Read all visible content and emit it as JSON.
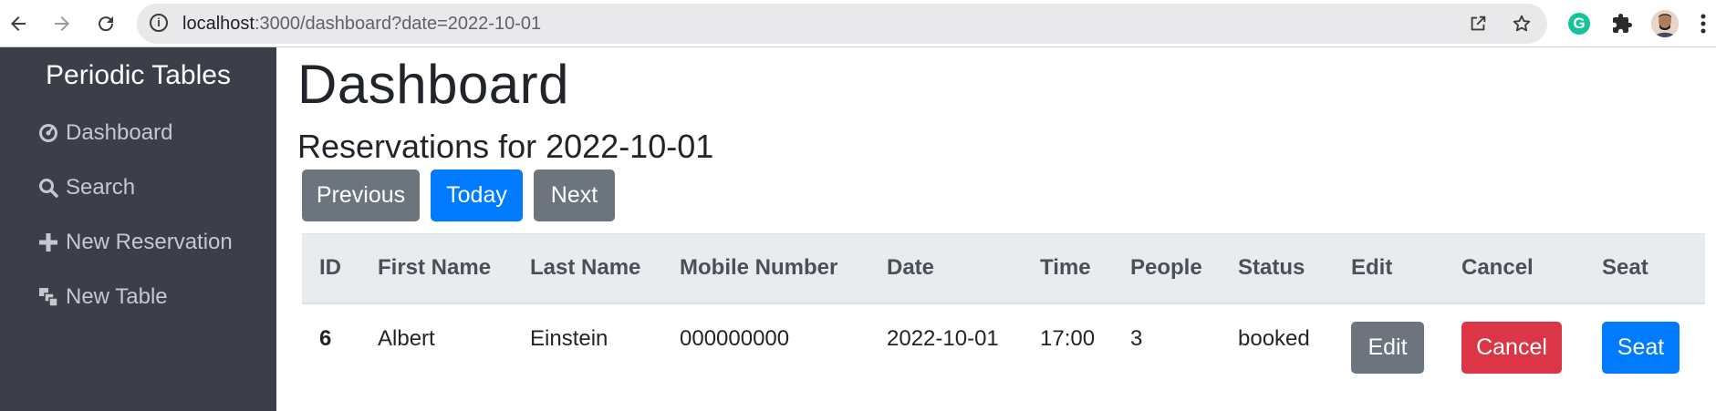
{
  "browser": {
    "url_host": "localhost",
    "url_rest": ":3000/dashboard?date=2022-10-01",
    "icons": {
      "back": "back-arrow-icon",
      "forward": "forward-arrow-icon",
      "reload": "reload-icon",
      "info": "site-info-icon",
      "share": "share-icon",
      "bookmark": "star-icon",
      "grammarly": "grammarly-icon",
      "extensions": "puzzle-icon",
      "profile": "avatar",
      "menu": "kebab-menu-icon"
    },
    "grammarly_letter": "G"
  },
  "sidebar": {
    "brand": "Periodic Tables",
    "items": [
      {
        "label": "Dashboard",
        "icon": "dashboard-icon"
      },
      {
        "label": "Search",
        "icon": "search-icon"
      },
      {
        "label": "New Reservation",
        "icon": "plus-icon"
      },
      {
        "label": "New Table",
        "icon": "table-icon"
      }
    ],
    "colors": {
      "background": "#3c3e49",
      "text": "#c6c8cf",
      "brand": "#ffffff"
    }
  },
  "main": {
    "title": "Dashboard",
    "subtitle": "Reservations for 2022-10-01",
    "nav_buttons": {
      "previous": "Previous",
      "today": "Today",
      "next": "Next"
    },
    "table": {
      "headers": [
        "ID",
        "First Name",
        "Last Name",
        "Mobile Number",
        "Date",
        "Time",
        "People",
        "Status",
        "Edit",
        "Cancel",
        "Seat"
      ],
      "rows": [
        {
          "id": "6",
          "first_name": "Albert",
          "last_name": "Einstein",
          "mobile_number": "000000000",
          "date": "2022-10-01",
          "time": "17:00",
          "people": "3",
          "status": "booked",
          "edit_label": "Edit",
          "cancel_label": "Cancel",
          "seat_label": "Seat"
        }
      ]
    },
    "colors": {
      "primary": "#007bff",
      "secondary": "#6c757d",
      "danger": "#dc3545",
      "table_header_bg": "#e9ecef"
    }
  }
}
